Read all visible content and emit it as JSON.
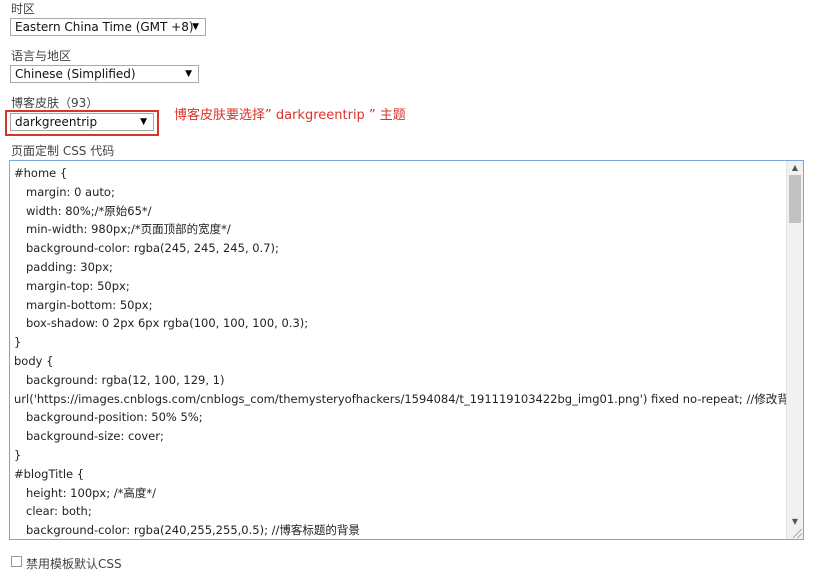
{
  "timezone": {
    "label": "时区",
    "selected": "Eastern China Time (GMT +8)",
    "arrow": "▼"
  },
  "language": {
    "label": "语言与地区",
    "selected": "Chinese (Simplified)",
    "arrow": "▼"
  },
  "skin": {
    "label": "博客皮肤（93）",
    "selected": "darkgreentrip",
    "arrow": "▼",
    "annotation": "博客皮肤要选择” darkgreentrip ” 主题",
    "highlight_color": "#d9342b"
  },
  "css_editor": {
    "label": "页面定制 CSS 代码",
    "lines": [
      {
        "text": "#home {",
        "indent": false
      },
      {
        "text": "margin: 0 auto;",
        "indent": true
      },
      {
        "text": "width: 80%;/*原始65*/",
        "indent": true
      },
      {
        "text": "min-width: 980px;/*页面顶部的宽度*/",
        "indent": true
      },
      {
        "text": "background-color: rgba(245, 245, 245, 0.7);",
        "indent": true
      },
      {
        "text": "padding: 30px;",
        "indent": true
      },
      {
        "text": "margin-top: 50px;",
        "indent": true
      },
      {
        "text": "margin-bottom: 50px;",
        "indent": true
      },
      {
        "text": "box-shadow: 0 2px 6px rgba(100, 100, 100, 0.3);",
        "indent": true
      },
      {
        "text": "}",
        "indent": false
      },
      {
        "text": "body {",
        "indent": false
      },
      {
        "text": "background: rgba(12, 100, 129, 1)",
        "indent": true
      },
      {
        "text": "url('https://images.cnblogs.com/cnblogs_com/themysteryofhackers/1594084/t_191119103422bg_img01.png') fixed no-repeat;   //修改背景图片",
        "indent": false
      },
      {
        "text": "background-position: 50% 5%;",
        "indent": true
      },
      {
        "text": "background-size: cover;",
        "indent": true
      },
      {
        "text": "}",
        "indent": false
      },
      {
        "text": "#blogTitle {",
        "indent": false
      },
      {
        "text": "height: 100px;  /*高度*/",
        "indent": true
      },
      {
        "text": "clear: both;",
        "indent": true
      },
      {
        "text": "background-color: rgba(240,255,255,0.5);   //博客标题的背景",
        "indent": true
      }
    ],
    "scroll_up": "▲",
    "scroll_down": "▼",
    "border_color": "#7aa7d6"
  },
  "disable_default_css": {
    "label": "禁用模板默认CSS",
    "checked": false
  }
}
